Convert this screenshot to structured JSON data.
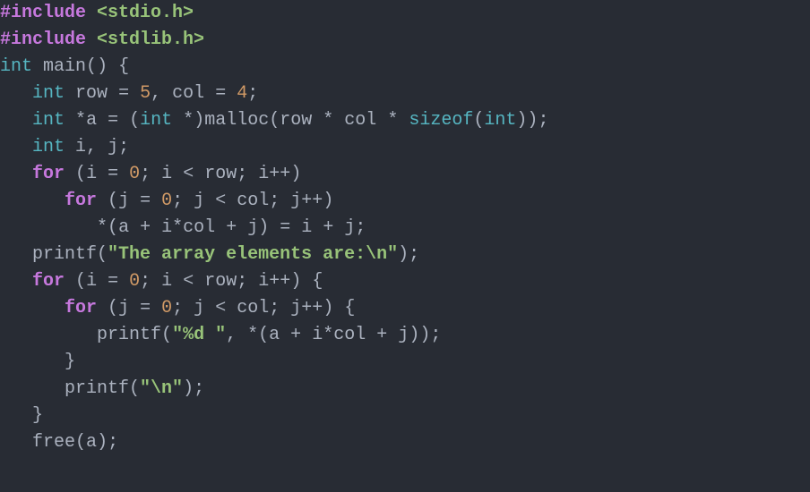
{
  "code": {
    "include1_directive": "#include",
    "include1_header": "<stdio.h>",
    "include2_directive": "#include",
    "include2_header": "<stdlib.h>",
    "type_int": "int",
    "fn_main": "main",
    "paren_open": "(",
    "paren_close": ")",
    "brace_open": "{",
    "brace_close": "}",
    "id_row": "row",
    "eq": "=",
    "val_5": "5",
    "comma": ",",
    "id_col": "col",
    "val_4": "4",
    "semi": ";",
    "star": "*",
    "id_a": "a",
    "fn_malloc": "malloc",
    "fn_sizeof": "sizeof",
    "id_i": "i",
    "id_j": "j",
    "kw_for": "for",
    "val_0": "0",
    "lt": "<",
    "inc": "++",
    "plus": "+",
    "fn_printf": "printf",
    "str_header": "\"The array elements are:\\n\"",
    "str_fmt": "\"%d \"",
    "str_nl": "\"\\n\"",
    "fn_free": "free"
  }
}
